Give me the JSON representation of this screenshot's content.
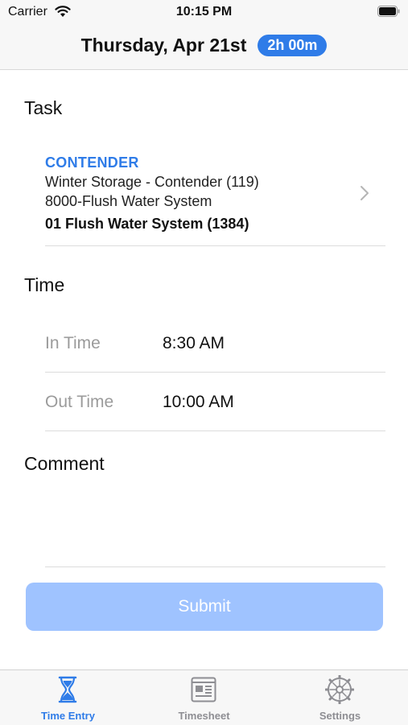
{
  "status_bar": {
    "carrier": "Carrier",
    "time": "10:15 PM"
  },
  "header": {
    "title": "Thursday, Apr 21st",
    "duration": "2h 00m"
  },
  "task_section": {
    "label": "Task",
    "company": "CONTENDER",
    "job": "Winter Storage - Contender (119)",
    "system": "8000-Flush Water System",
    "code": "01 Flush Water System (1384)"
  },
  "time_section": {
    "label": "Time",
    "in_label": "In Time",
    "in_value": "8:30 AM",
    "out_label": "Out Time",
    "out_value": "10:00 AM"
  },
  "comment_section": {
    "label": "Comment",
    "value": ""
  },
  "submit": {
    "label": "Submit"
  },
  "tabs": [
    {
      "label": "Time Entry",
      "icon": "hourglass-icon",
      "active": true
    },
    {
      "label": "Timesheet",
      "icon": "timesheet-icon",
      "active": false
    },
    {
      "label": "Settings",
      "icon": "gear-icon",
      "active": false
    }
  ],
  "colors": {
    "accent": "#2f7ce8",
    "submit_disabled": "#9fc3ff",
    "inactive_tab": "#8e8e93",
    "secondary_text": "#9b9b9b"
  }
}
